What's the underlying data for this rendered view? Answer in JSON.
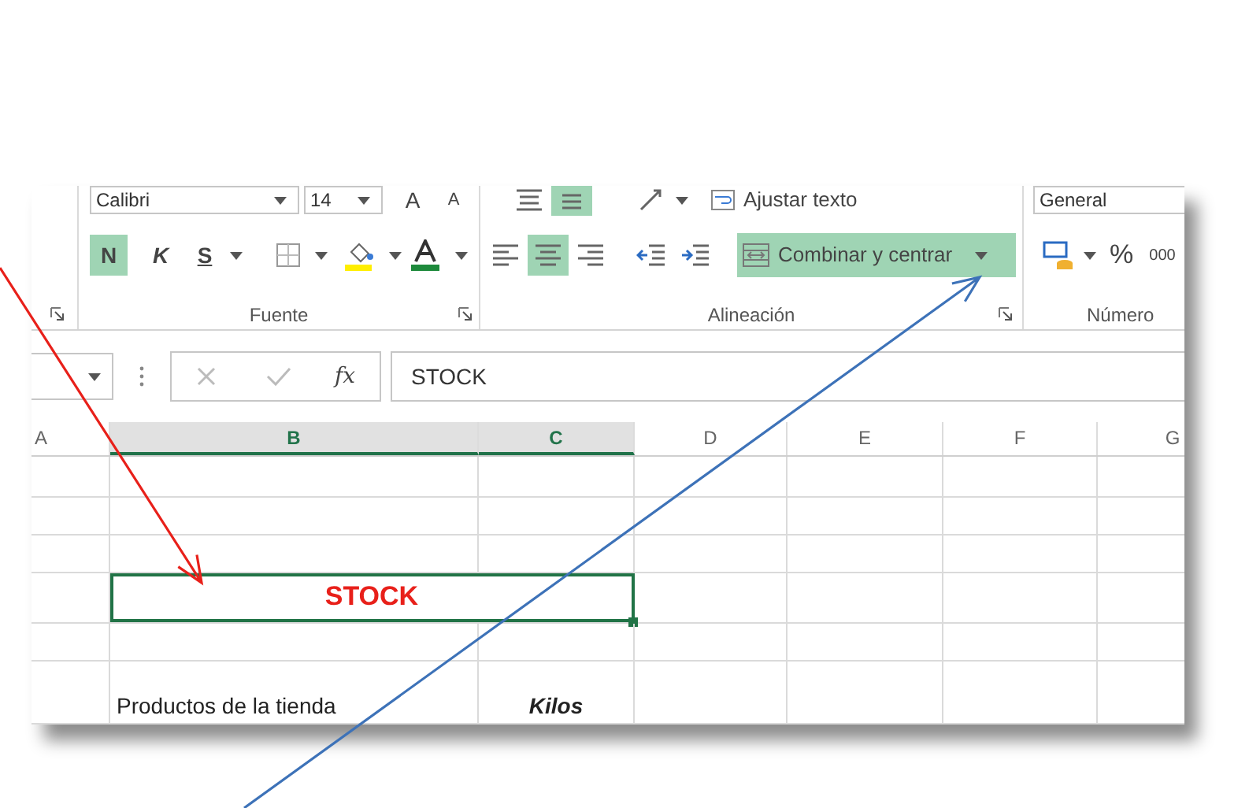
{
  "ribbon": {
    "font_group": {
      "label": "Fuente",
      "font_name": "Calibri",
      "font_size": "14",
      "grow_label": "A",
      "shrink_label": "A",
      "style_buttons": [
        {
          "kind": "bold",
          "label": "N",
          "selected": true
        },
        {
          "kind": "italic",
          "label": "K",
          "selected": false
        },
        {
          "kind": "underline",
          "label": "S",
          "selected": false
        }
      ]
    },
    "alignment_group": {
      "label": "Alineación",
      "wrap_text": "Ajustar texto",
      "vertical_align": [
        {
          "kind": "top",
          "selected": false
        },
        {
          "kind": "middle",
          "selected": true
        }
      ],
      "horizontal_align": [
        {
          "kind": "left",
          "selected": false
        },
        {
          "kind": "center",
          "selected": true
        },
        {
          "kind": "right",
          "selected": false
        }
      ],
      "merge_button": {
        "label": "Combinar y centrar",
        "selected": true
      }
    },
    "number_group": {
      "label": "Número",
      "format": "General",
      "percent": "%",
      "thousands": "000"
    }
  },
  "formula_bar": {
    "function_label": "fx",
    "value": "STOCK"
  },
  "sheet": {
    "columns": [
      {
        "label": "A",
        "selected": false
      },
      {
        "label": "B",
        "selected": true
      },
      {
        "label": "C",
        "selected": true
      },
      {
        "label": "D",
        "selected": false
      },
      {
        "label": "E",
        "selected": false
      },
      {
        "label": "F",
        "selected": false
      },
      {
        "label": "G",
        "selected": false
      }
    ],
    "rows": [
      {
        "kind": "blank"
      },
      {
        "kind": "blank"
      },
      {
        "kind": "blank"
      },
      {
        "kind": "title",
        "text": "STOCK",
        "color": "#e8201a",
        "selected": true
      },
      {
        "kind": "blank"
      },
      {
        "kind": "header",
        "product": "Productos de la tienda",
        "unit": "Kilos"
      }
    ]
  },
  "annotation_arrows": [
    {
      "color": "#e8201a"
    },
    {
      "color": "#3d72b8"
    }
  ]
}
